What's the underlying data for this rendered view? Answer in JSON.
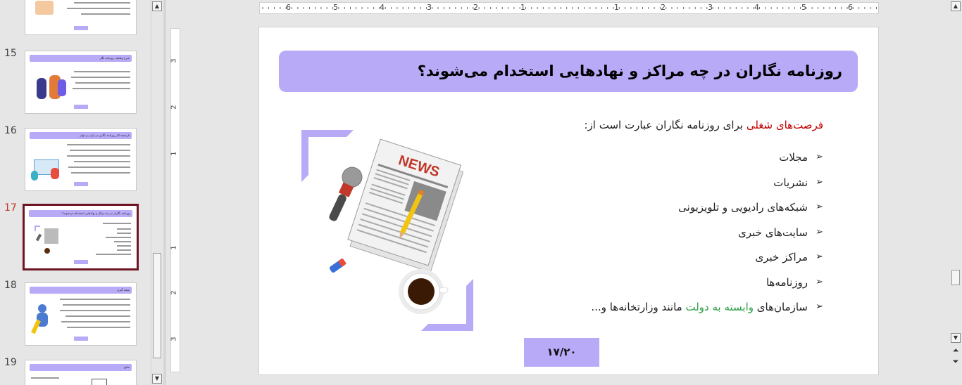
{
  "thumbnails": [
    {
      "num": "15",
      "title": "شرح وظایف روزنامه نگار",
      "active": false
    },
    {
      "num": "16",
      "title": "تاریخچه کار روزنامه نگاری در ایران و جهان",
      "active": false
    },
    {
      "num": "17",
      "title": "روزنامه نگاران در چه مراکز و نهادهایی استخدام می‌شوند؟",
      "active": true
    },
    {
      "num": "18",
      "title": "نتیجه گیری",
      "active": false
    },
    {
      "num": "19",
      "title": "منابع",
      "active": false
    }
  ],
  "ruler": {
    "h_labels": [
      "6",
      "5",
      "4",
      "3",
      "2",
      "1",
      "1",
      "2",
      "3",
      "4",
      "5",
      "6"
    ],
    "v_labels": [
      "3",
      "2",
      "1",
      "1",
      "2",
      "3"
    ]
  },
  "slide": {
    "title": "روزنامه نگاران در چه مراکز و نهادهایی استخدام می‌شوند؟",
    "intro_highlight": "فرصت‌های شغلی",
    "intro_rest": " برای روزنامه نگاران عبارت است از:",
    "bullets": [
      "مجلات",
      "نشریات",
      "شبکه‌های رادیویی و تلویزیونی",
      "سایت‌های خبری",
      "مراکز خبری",
      "روزنامه‌ها"
    ],
    "last_bullet_pre": "سازمان‌های ",
    "last_bullet_green": "وابسته به دولت",
    "last_bullet_post": " مانند وزارتخانه‌ها و...",
    "page_label": "۱۷/۲۰",
    "news_label": "NEWS",
    "bullet_glyph": "➢"
  },
  "colors": {
    "accent": "#b8aaf7",
    "active_border": "#6e1423",
    "highlight_red": "#c00000",
    "highlight_green": "#2ea043"
  },
  "icons": {
    "scroll_up": "▲",
    "scroll_down": "▼",
    "prev_slide": "⏶",
    "next_slide": "⏷"
  }
}
